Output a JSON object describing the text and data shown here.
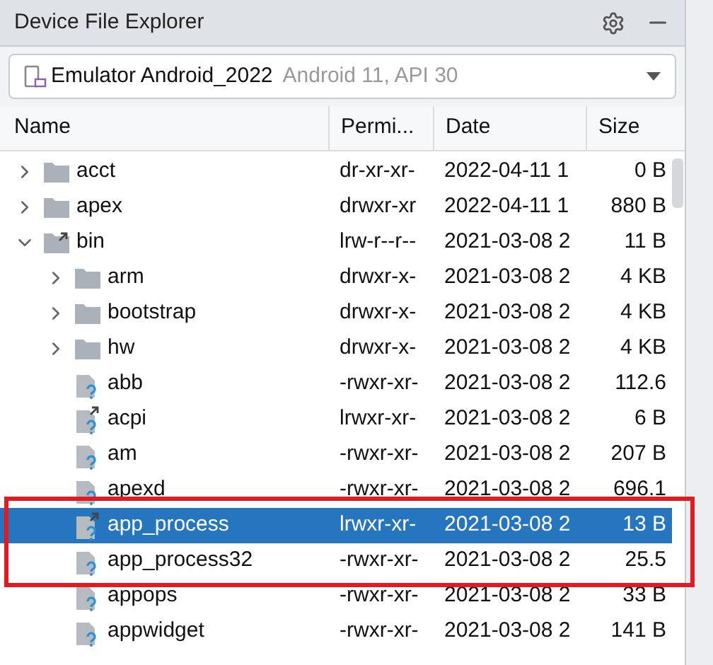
{
  "panel": {
    "title": "Device File Explorer"
  },
  "device_select": {
    "device": "Emulator Android_2022",
    "detail": "Android 11, API 30"
  },
  "table": {
    "columns": [
      "Name",
      "Permi...",
      "Date",
      "Size"
    ],
    "rows": [
      {
        "kind": "folder",
        "name": "acct",
        "permissions": "dr-xr-xr-",
        "date": "2022-04-11 1",
        "size": "0 B",
        "expanded": false,
        "selected": false
      },
      {
        "kind": "folder",
        "name": "apex",
        "permissions": "drwxr-xr",
        "date": "2022-04-11 1",
        "size": "880 B",
        "expanded": false,
        "selected": false
      },
      {
        "kind": "folder-link",
        "name": "bin",
        "permissions": "lrw-r--r--",
        "date": "2021-03-08 2",
        "size": "11 B",
        "expanded": true,
        "selected": false,
        "children": [
          {
            "kind": "folder",
            "name": "arm",
            "permissions": "drwxr-x-",
            "date": "2021-03-08 2",
            "size": "4 KB",
            "expanded": false,
            "selected": false
          },
          {
            "kind": "folder",
            "name": "bootstrap",
            "permissions": "drwxr-x-",
            "date": "2021-03-08 2",
            "size": "4 KB",
            "expanded": false,
            "selected": false
          },
          {
            "kind": "folder",
            "name": "hw",
            "permissions": "drwxr-x-",
            "date": "2021-03-08 2",
            "size": "4 KB",
            "expanded": false,
            "selected": false
          },
          {
            "kind": "file",
            "name": "abb",
            "permissions": "-rwxr-xr-",
            "date": "2021-03-08 2",
            "size": "112.6",
            "selected": false
          },
          {
            "kind": "file-link",
            "name": "acpi",
            "permissions": "lrwxr-xr-",
            "date": "2021-03-08 2",
            "size": "6 B",
            "selected": false
          },
          {
            "kind": "file",
            "name": "am",
            "permissions": "-rwxr-xr-",
            "date": "2021-03-08 2",
            "size": "207 B",
            "selected": false
          },
          {
            "kind": "file",
            "name": "apexd",
            "permissions": "-rwxr-xr-",
            "date": "2021-03-08 2",
            "size": "696.1",
            "selected": false
          },
          {
            "kind": "file-link",
            "name": "app_process",
            "permissions": "lrwxr-xr-",
            "date": "2021-03-08 2",
            "size": "13 B",
            "selected": true
          },
          {
            "kind": "file",
            "name": "app_process32",
            "permissions": "-rwxr-xr-",
            "date": "2021-03-08 2",
            "size": "25.5",
            "selected": false
          },
          {
            "kind": "file",
            "name": "appops",
            "permissions": "-rwxr-xr-",
            "date": "2021-03-08 2",
            "size": "33 B",
            "selected": false
          },
          {
            "kind": "file",
            "name": "appwidget",
            "permissions": "-rwxr-xr-",
            "date": "2021-03-08 2",
            "size": "141 B",
            "selected": false
          }
        ]
      }
    ]
  }
}
